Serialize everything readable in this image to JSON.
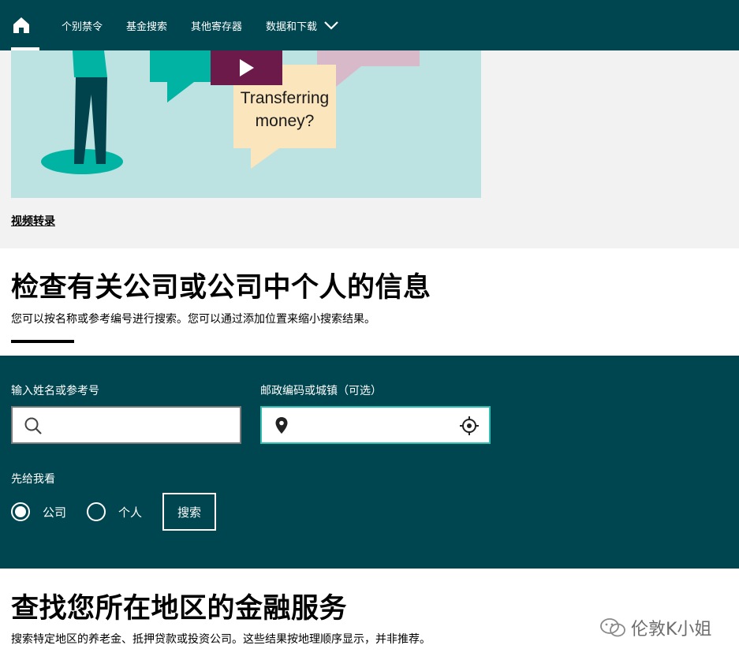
{
  "nav": {
    "items": [
      "个别禁令",
      "基金搜索",
      "其他寄存器",
      "数据和下载"
    ],
    "home_icon": "home-icon",
    "dropdown_icon": "chevron-down-icon"
  },
  "video": {
    "speech_bubbles": [
      "mone",
      "Transferring money?"
    ],
    "transcript_link": "视频转录"
  },
  "check": {
    "title": "检查有关公司或公司中个人的信息",
    "subtitle": "您可以按名称或参考编号进行搜索。您可以通过添加位置来缩小搜索结果。"
  },
  "search": {
    "name_label": "输入姓名或参考号",
    "name_value": "",
    "location_label": "邮政编码或城镇（可选）",
    "location_value": "",
    "show_first_label": "先给我看",
    "options": [
      {
        "label": "公司",
        "selected": true
      },
      {
        "label": "个人",
        "selected": false
      }
    ],
    "button": "搜索"
  },
  "find": {
    "title": "查找您所在地区的金融服务",
    "subtitle": "搜索特定地区的养老金、抵押贷款或投资公司。这些结果按地理顺序显示，并非推荐。"
  },
  "watermark": "伦敦K小姐",
  "colors": {
    "nav_bg": "#004650",
    "panel_bg": "#004650",
    "accent_teal": "#30bfb0",
    "illustration_bg": "#bce3e1",
    "play_bg": "#6b1a4a"
  }
}
